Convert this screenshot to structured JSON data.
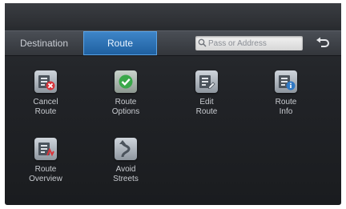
{
  "tabs": {
    "destination": "Destination",
    "route": "Route"
  },
  "search": {
    "placeholder": "Pass or Address",
    "icon": "search-icon"
  },
  "back": {
    "icon": "back-arrow-icon"
  },
  "menu": {
    "items": [
      {
        "line1": "Cancel",
        "line2": "Route",
        "icon": "cancel-route-icon"
      },
      {
        "line1": "Route",
        "line2": "Options",
        "icon": "checkmark-icon"
      },
      {
        "line1": "Edit",
        "line2": "Route",
        "icon": "edit-route-icon"
      },
      {
        "line1": "Route",
        "line2": "Info",
        "icon": "route-info-icon"
      },
      {
        "line1": "Route",
        "line2": "Overview",
        "icon": "route-overview-icon"
      },
      {
        "line1": "Avoid",
        "line2": "Streets",
        "icon": "avoid-streets-icon"
      }
    ]
  },
  "colors": {
    "accent_tab": "#2a72b8",
    "screen_bg": "#212327",
    "cancel_red": "#d8343a",
    "options_green": "#3aa84a"
  }
}
